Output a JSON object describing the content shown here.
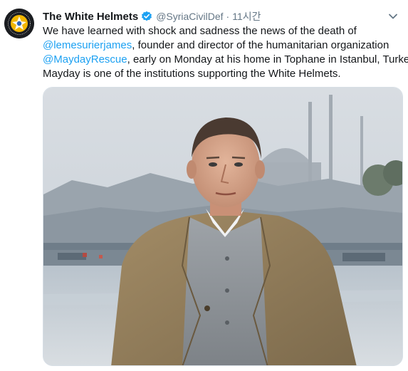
{
  "tweet": {
    "author_name": "The White Helmets",
    "verified": true,
    "handle": "@SyriaCivilDef",
    "separator": "·",
    "time": "11시간",
    "avatar_icon": "white-helmets-logo",
    "text": {
      "l1": "We have learned with shock and sadness the news of the death of",
      "l2_mention": "@lemesurierjames",
      "l2_rest": ", founder and director of the humanitarian organization",
      "l3_mention": "@MaydayRescue",
      "l3_rest": ", early on Monday at his home in Tophane in Istanbul, Turkey.",
      "l4": "Mayday is one of the institutions supporting the White Helmets."
    },
    "photo_alt": "",
    "colors": {
      "mention": "#1da1f2",
      "secondary": "#657786",
      "verified": "#1da1f2"
    }
  }
}
